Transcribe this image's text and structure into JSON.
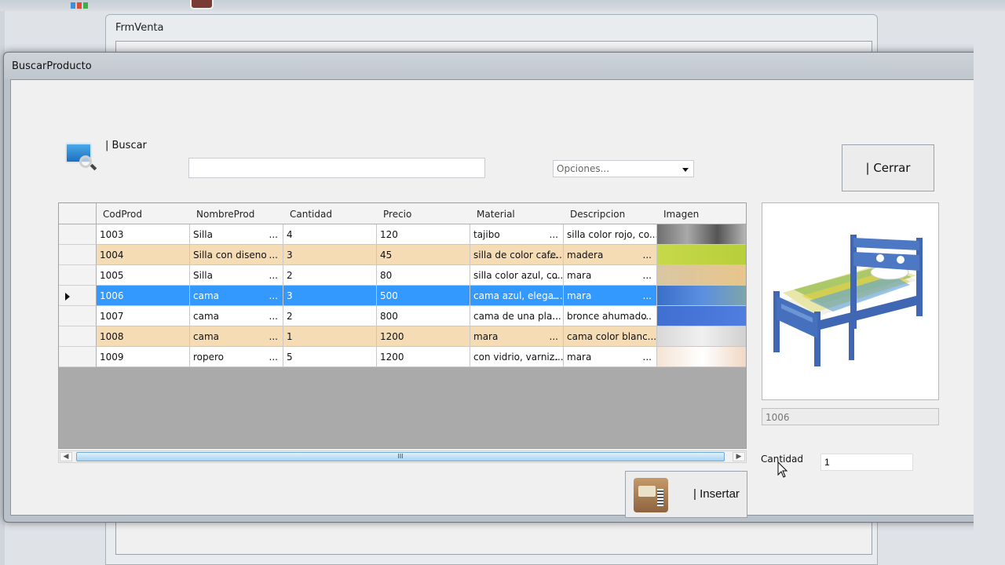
{
  "background_window": {
    "title": "FrmVenta"
  },
  "dialog": {
    "title": "BuscarProducto",
    "search_label": "| Buscar",
    "search_value": "",
    "options_placeholder": "Opciones...",
    "close_label": "| Cerrar",
    "insert_label": "| Insertar",
    "cantidad_label": "Cantidad",
    "cantidad_value": "1",
    "selected_id": "1006"
  },
  "grid": {
    "columns": [
      "CodProd",
      "NombreProd",
      "Cantidad",
      "Precio",
      "Material",
      "Descripcion",
      "Imagen"
    ],
    "rows": [
      {
        "cod": "1003",
        "nombre": "Silla",
        "cantidad": "4",
        "precio": "120",
        "material": "tajibo",
        "descripcion": "silla color rojo, co...",
        "style": "white",
        "selected": false
      },
      {
        "cod": "1004",
        "nombre": "Silla con diseno",
        "cantidad": "3",
        "precio": "45",
        "material": "silla de color cafe...",
        "descripcion": "madera",
        "style": "alt",
        "selected": false
      },
      {
        "cod": "1005",
        "nombre": "Silla",
        "cantidad": "2",
        "precio": "80",
        "material": "silla color azul, co...",
        "descripcion": "mara",
        "style": "white",
        "selected": false
      },
      {
        "cod": "1006",
        "nombre": "cama",
        "cantidad": "3",
        "precio": "500",
        "material": "cama azul, elega...",
        "descripcion": "mara",
        "style": "sel",
        "selected": true
      },
      {
        "cod": "1007",
        "nombre": "cama",
        "cantidad": "2",
        "precio": "800",
        "material": "cama de una pla...",
        "descripcion": "bronce ahumado",
        "style": "white",
        "selected": false
      },
      {
        "cod": "1008",
        "nombre": "cama",
        "cantidad": "1",
        "precio": "1200",
        "material": "mara",
        "descripcion": "cama color blanc...",
        "style": "alt",
        "selected": false
      },
      {
        "cod": "1009",
        "nombre": "ropero",
        "cantidad": "5",
        "precio": "1200",
        "material": "con vidrio, varniz...",
        "descripcion": "mara",
        "style": "white",
        "selected": false
      }
    ],
    "scroll_thumb_text": "III",
    "colors": {
      "alt_row": "#f5dcb5",
      "selected_row": "#3399ff",
      "grid_empty": "#aaaaaa"
    }
  }
}
